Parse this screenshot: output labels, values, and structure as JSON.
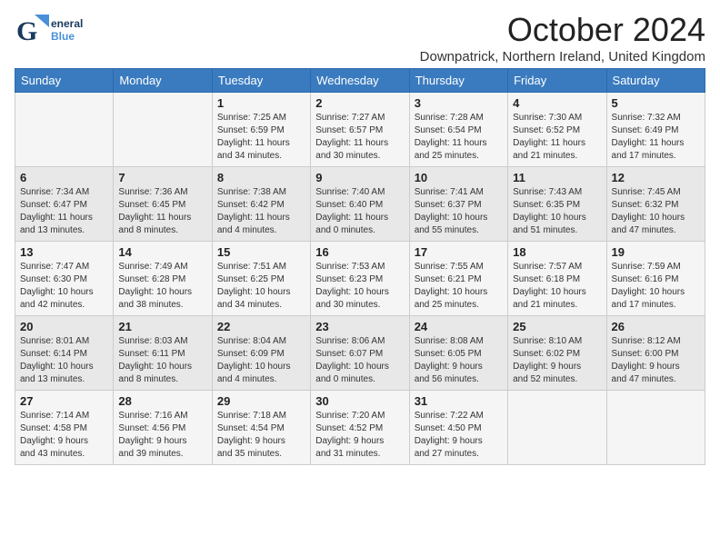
{
  "header": {
    "logo_general": "General",
    "logo_blue": "Blue",
    "month": "October 2024",
    "location": "Downpatrick, Northern Ireland, United Kingdom"
  },
  "weekdays": [
    "Sunday",
    "Monday",
    "Tuesday",
    "Wednesday",
    "Thursday",
    "Friday",
    "Saturday"
  ],
  "weeks": [
    [
      {
        "day": "",
        "info": ""
      },
      {
        "day": "",
        "info": ""
      },
      {
        "day": "1",
        "info": "Sunrise: 7:25 AM\nSunset: 6:59 PM\nDaylight: 11 hours\nand 34 minutes."
      },
      {
        "day": "2",
        "info": "Sunrise: 7:27 AM\nSunset: 6:57 PM\nDaylight: 11 hours\nand 30 minutes."
      },
      {
        "day": "3",
        "info": "Sunrise: 7:28 AM\nSunset: 6:54 PM\nDaylight: 11 hours\nand 25 minutes."
      },
      {
        "day": "4",
        "info": "Sunrise: 7:30 AM\nSunset: 6:52 PM\nDaylight: 11 hours\nand 21 minutes."
      },
      {
        "day": "5",
        "info": "Sunrise: 7:32 AM\nSunset: 6:49 PM\nDaylight: 11 hours\nand 17 minutes."
      }
    ],
    [
      {
        "day": "6",
        "info": "Sunrise: 7:34 AM\nSunset: 6:47 PM\nDaylight: 11 hours\nand 13 minutes."
      },
      {
        "day": "7",
        "info": "Sunrise: 7:36 AM\nSunset: 6:45 PM\nDaylight: 11 hours\nand 8 minutes."
      },
      {
        "day": "8",
        "info": "Sunrise: 7:38 AM\nSunset: 6:42 PM\nDaylight: 11 hours\nand 4 minutes."
      },
      {
        "day": "9",
        "info": "Sunrise: 7:40 AM\nSunset: 6:40 PM\nDaylight: 11 hours\nand 0 minutes."
      },
      {
        "day": "10",
        "info": "Sunrise: 7:41 AM\nSunset: 6:37 PM\nDaylight: 10 hours\nand 55 minutes."
      },
      {
        "day": "11",
        "info": "Sunrise: 7:43 AM\nSunset: 6:35 PM\nDaylight: 10 hours\nand 51 minutes."
      },
      {
        "day": "12",
        "info": "Sunrise: 7:45 AM\nSunset: 6:32 PM\nDaylight: 10 hours\nand 47 minutes."
      }
    ],
    [
      {
        "day": "13",
        "info": "Sunrise: 7:47 AM\nSunset: 6:30 PM\nDaylight: 10 hours\nand 42 minutes."
      },
      {
        "day": "14",
        "info": "Sunrise: 7:49 AM\nSunset: 6:28 PM\nDaylight: 10 hours\nand 38 minutes."
      },
      {
        "day": "15",
        "info": "Sunrise: 7:51 AM\nSunset: 6:25 PM\nDaylight: 10 hours\nand 34 minutes."
      },
      {
        "day": "16",
        "info": "Sunrise: 7:53 AM\nSunset: 6:23 PM\nDaylight: 10 hours\nand 30 minutes."
      },
      {
        "day": "17",
        "info": "Sunrise: 7:55 AM\nSunset: 6:21 PM\nDaylight: 10 hours\nand 25 minutes."
      },
      {
        "day": "18",
        "info": "Sunrise: 7:57 AM\nSunset: 6:18 PM\nDaylight: 10 hours\nand 21 minutes."
      },
      {
        "day": "19",
        "info": "Sunrise: 7:59 AM\nSunset: 6:16 PM\nDaylight: 10 hours\nand 17 minutes."
      }
    ],
    [
      {
        "day": "20",
        "info": "Sunrise: 8:01 AM\nSunset: 6:14 PM\nDaylight: 10 hours\nand 13 minutes."
      },
      {
        "day": "21",
        "info": "Sunrise: 8:03 AM\nSunset: 6:11 PM\nDaylight: 10 hours\nand 8 minutes."
      },
      {
        "day": "22",
        "info": "Sunrise: 8:04 AM\nSunset: 6:09 PM\nDaylight: 10 hours\nand 4 minutes."
      },
      {
        "day": "23",
        "info": "Sunrise: 8:06 AM\nSunset: 6:07 PM\nDaylight: 10 hours\nand 0 minutes."
      },
      {
        "day": "24",
        "info": "Sunrise: 8:08 AM\nSunset: 6:05 PM\nDaylight: 9 hours\nand 56 minutes."
      },
      {
        "day": "25",
        "info": "Sunrise: 8:10 AM\nSunset: 6:02 PM\nDaylight: 9 hours\nand 52 minutes."
      },
      {
        "day": "26",
        "info": "Sunrise: 8:12 AM\nSunset: 6:00 PM\nDaylight: 9 hours\nand 47 minutes."
      }
    ],
    [
      {
        "day": "27",
        "info": "Sunrise: 7:14 AM\nSunset: 4:58 PM\nDaylight: 9 hours\nand 43 minutes."
      },
      {
        "day": "28",
        "info": "Sunrise: 7:16 AM\nSunset: 4:56 PM\nDaylight: 9 hours\nand 39 minutes."
      },
      {
        "day": "29",
        "info": "Sunrise: 7:18 AM\nSunset: 4:54 PM\nDaylight: 9 hours\nand 35 minutes."
      },
      {
        "day": "30",
        "info": "Sunrise: 7:20 AM\nSunset: 4:52 PM\nDaylight: 9 hours\nand 31 minutes."
      },
      {
        "day": "31",
        "info": "Sunrise: 7:22 AM\nSunset: 4:50 PM\nDaylight: 9 hours\nand 27 minutes."
      },
      {
        "day": "",
        "info": ""
      },
      {
        "day": "",
        "info": ""
      }
    ]
  ]
}
